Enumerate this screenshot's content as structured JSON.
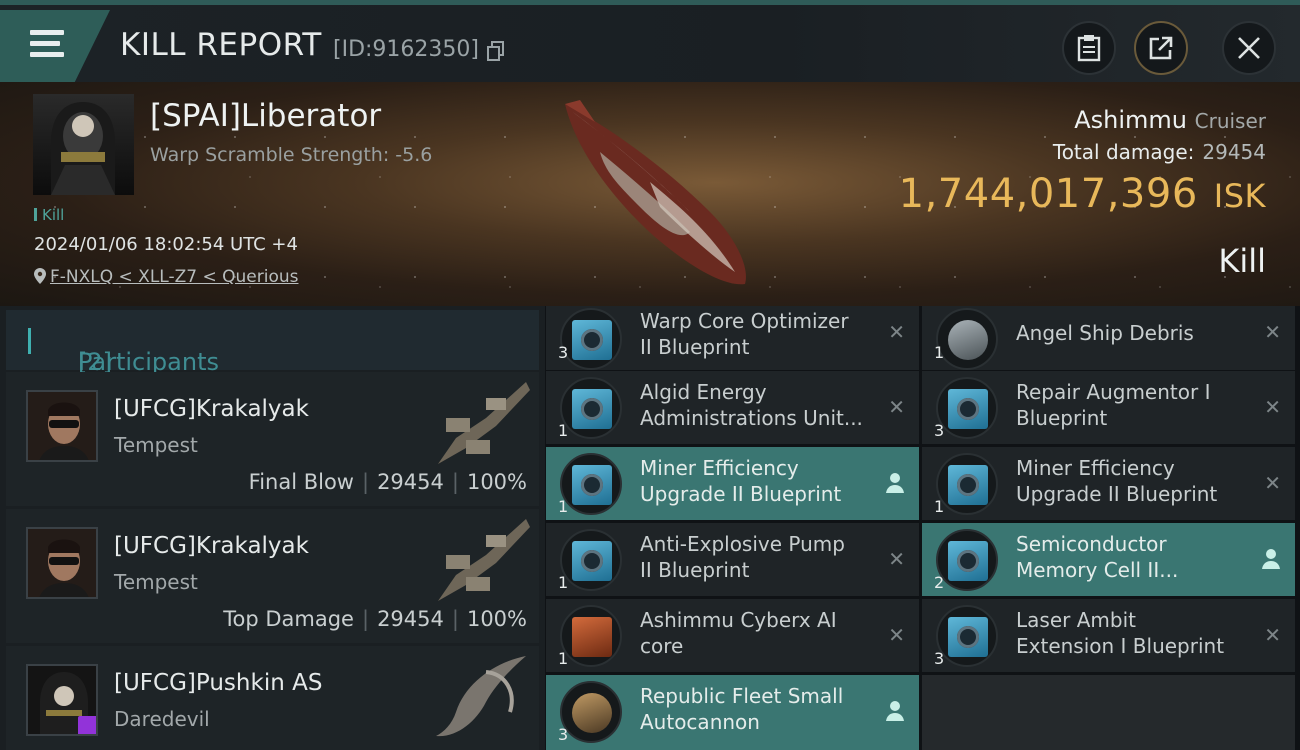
{
  "header": {
    "title": "KILL REPORT",
    "id_text": "[ID:9162350]"
  },
  "victim": {
    "name": "[SPAI]Liberator",
    "warp_scramble": "Warp Scramble Strength: -5.6",
    "tag": "Kill",
    "timestamp": "2024/01/06 18:02:54 UTC +4",
    "location": "F-NXLQ < XLL-Z7 < Querious",
    "ship_name": "Ashimmu",
    "ship_class": "Cruiser",
    "total_damage_label": "Total damage:",
    "total_damage": "29454",
    "isk_value": "1,744,017,396",
    "isk_currency": "ISK",
    "result": "Kill"
  },
  "participants": {
    "title": "Participants",
    "count": "[2]",
    "rows": [
      {
        "name": "[UFCG]Krakalyak",
        "ship": "Tempest",
        "role": "Final Blow",
        "damage": "29454",
        "percent": "100%"
      },
      {
        "name": "[UFCG]Krakalyak",
        "ship": "Tempest",
        "role": "Top Damage",
        "damage": "29454",
        "percent": "100%"
      },
      {
        "name": "[UFCG]Pushkin AS",
        "ship": "Daredevil",
        "role": "",
        "damage": "",
        "percent": ""
      }
    ]
  },
  "items_left": [
    {
      "qty": "3",
      "line1": "Warp Core Optimizer",
      "line2": "II Blueprint",
      "status": "destroyed"
    },
    {
      "qty": "1",
      "line1": "Algid Energy",
      "line2": "Administrations Unit...",
      "status": "destroyed"
    },
    {
      "qty": "1",
      "line1": "Miner Efficiency",
      "line2": "Upgrade II Blueprint",
      "status": "dropped"
    },
    {
      "qty": "1",
      "line1": "Anti-Explosive Pump",
      "line2": "II Blueprint",
      "status": "destroyed"
    },
    {
      "qty": "1",
      "line1": "Ashimmu Cyberx AI",
      "line2": "core",
      "status": "destroyed"
    },
    {
      "qty": "3",
      "line1": "Republic Fleet Small",
      "line2": "Autocannon",
      "status": "dropped"
    }
  ],
  "items_right": [
    {
      "qty": "1",
      "line1": "Angel Ship Debris",
      "line2": "",
      "status": "destroyed"
    },
    {
      "qty": "3",
      "line1": "Repair Augmentor I",
      "line2": "Blueprint",
      "status": "destroyed"
    },
    {
      "qty": "1",
      "line1": "Miner Efficiency",
      "line2": "Upgrade II Blueprint",
      "status": "destroyed"
    },
    {
      "qty": "2",
      "line1": "Semiconductor",
      "line2": "Memory Cell II...",
      "status": "dropped"
    },
    {
      "qty": "3",
      "line1": "Laser Ambit",
      "line2": "Extension I Blueprint",
      "status": "destroyed"
    }
  ],
  "colors": {
    "accent": "#2e5d58",
    "isk": "#e8b85a",
    "dropped": "#3a7672"
  }
}
